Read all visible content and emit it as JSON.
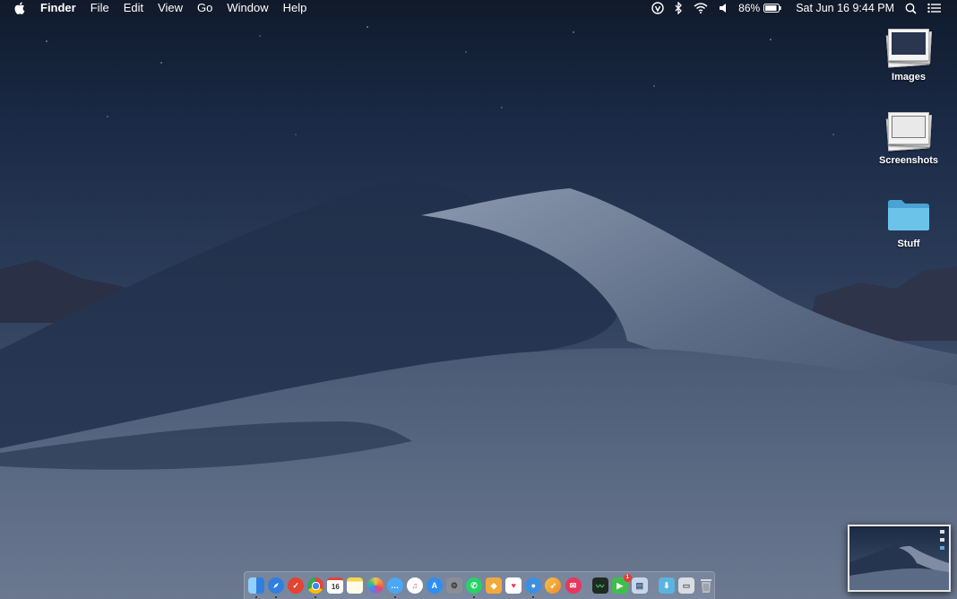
{
  "menubar": {
    "apple_icon": "apple-logo-icon",
    "app_name": "Finder",
    "menus": [
      "File",
      "Edit",
      "View",
      "Go",
      "Window",
      "Help"
    ],
    "status": {
      "battery_percent": "86%",
      "datetime": "Sat Jun 16  9:44 PM",
      "icons": [
        "vpn-status-icon",
        "bluetooth-icon",
        "wifi-icon",
        "volume-icon",
        "battery-icon",
        "spotlight-search-icon",
        "notification-center-icon"
      ]
    }
  },
  "desktop_items": [
    {
      "label": "Images",
      "icon": "image-stack-icon"
    },
    {
      "label": "Screenshots",
      "icon": "image-stack-icon"
    },
    {
      "label": "Stuff",
      "icon": "folder-icon"
    }
  ],
  "dock": {
    "apps": [
      {
        "name": "finder",
        "icon": "finder-icon",
        "color": "#3a8ee6",
        "running": true
      },
      {
        "name": "safari",
        "icon": "safari-icon",
        "color": "#2f7fe0",
        "running": true
      },
      {
        "name": "todoist",
        "icon": "todoist-icon",
        "color": "#e44332",
        "running": false
      },
      {
        "name": "chrome",
        "icon": "chrome-icon",
        "color": "#34a853",
        "running": true
      },
      {
        "name": "calendar",
        "icon": "calendar-icon",
        "color": "#ffffff",
        "label": "16",
        "running": false
      },
      {
        "name": "notes",
        "icon": "notes-icon",
        "color": "#f5d54a",
        "running": false
      },
      {
        "name": "photos",
        "icon": "photos-icon",
        "color": "#ef8a3c",
        "running": false
      },
      {
        "name": "messages",
        "icon": "messages-icon",
        "color": "#4aa8f5",
        "running": true
      },
      {
        "name": "itunes",
        "icon": "itunes-icon",
        "color": "#e0558d",
        "running": false
      },
      {
        "name": "app-store",
        "icon": "app-store-icon",
        "color": "#2e8ef2",
        "running": false
      },
      {
        "name": "system-preferences",
        "icon": "gear-icon",
        "color": "#8a8f96",
        "running": false
      },
      {
        "name": "whatsapp",
        "icon": "whatsapp-icon",
        "color": "#25d366",
        "running": true
      },
      {
        "name": "sketch",
        "icon": "sketch-icon",
        "color": "#f2a93b",
        "running": false
      },
      {
        "name": "pocket",
        "icon": "pocket-icon",
        "color": "#ef4056",
        "running": false
      },
      {
        "name": "tweetbot",
        "icon": "tweetbot-icon",
        "color": "#3d8fe0",
        "running": true
      },
      {
        "name": "rocket",
        "icon": "rocket-icon",
        "color": "#f08a2c",
        "running": false
      },
      {
        "name": "airmail",
        "icon": "airmail-icon",
        "color": "#e8365c",
        "running": false
      }
    ],
    "utilities": [
      {
        "name": "activity-monitor",
        "icon": "activity-monitor-icon",
        "color": "#1f2a22",
        "running": false
      },
      {
        "name": "facetime",
        "icon": "facetime-icon",
        "color": "#3fbf4a",
        "badge": "1",
        "running": false
      },
      {
        "name": "preview",
        "icon": "preview-icon",
        "color": "#c8d6e8",
        "running": false
      }
    ],
    "folders": [
      {
        "name": "downloads-stack",
        "icon": "downloads-folder-icon",
        "color": "#5ab4e0",
        "running": false
      },
      {
        "name": "documents-stack",
        "icon": "documents-stack-icon",
        "color": "#d8dde3",
        "running": false
      },
      {
        "name": "trash",
        "icon": "trash-icon",
        "color": "#b8bec6",
        "running": false
      }
    ]
  },
  "screenshot_preview": {
    "icon": "screenshot-thumbnail"
  }
}
